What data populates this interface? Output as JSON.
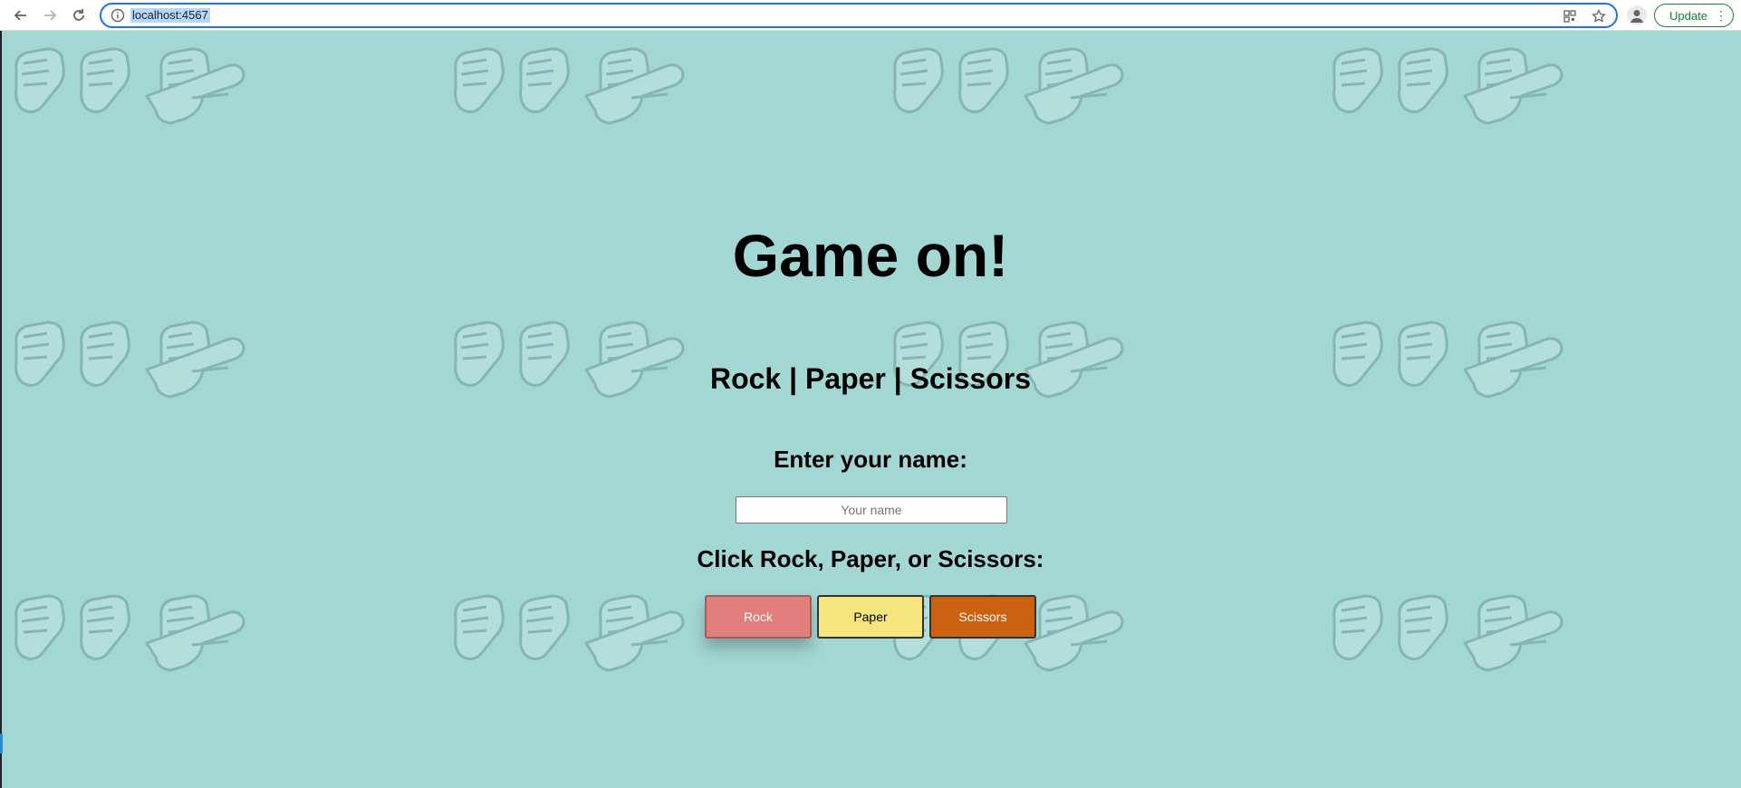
{
  "browser": {
    "url": "localhost:4567",
    "update_label": "Update"
  },
  "page": {
    "title": "Game on!",
    "subtitle": "Rock | Paper | Scissors",
    "name_prompt": "Enter your name:",
    "name_input": {
      "placeholder": "Your name",
      "value": ""
    },
    "choice_prompt": "Click Rock, Paper, or Scissors:",
    "buttons": {
      "rock": "Rock",
      "paper": "Paper",
      "scissors": "Scissors"
    }
  },
  "colors": {
    "background": "#a3d7d4",
    "rock": "#e07f7c",
    "paper": "#f5e57f",
    "scissors": "#cc6112"
  },
  "icons": [
    "back-arrow-icon",
    "forward-arrow-icon",
    "reload-icon",
    "info-icon",
    "qr-code-icon",
    "bookmark-star-icon",
    "profile-icon",
    "more-menu-icon",
    "hand-pattern-icon"
  ]
}
